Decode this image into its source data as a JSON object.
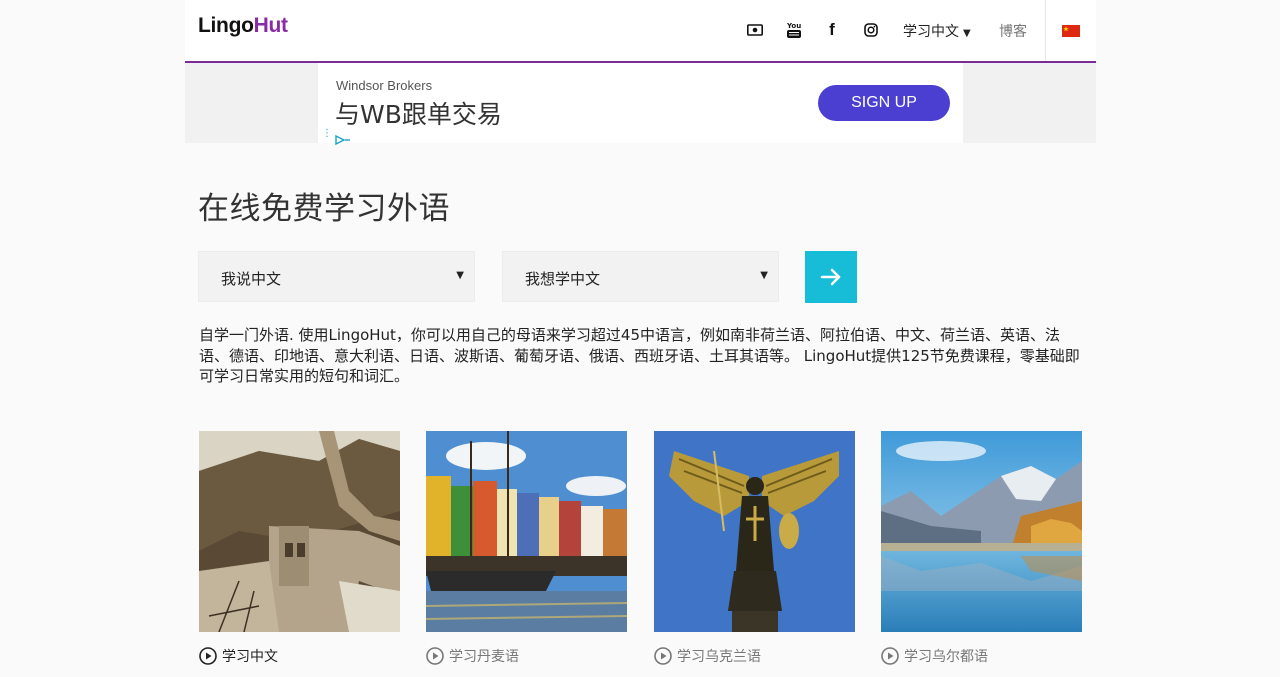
{
  "header": {
    "logo_part1": "Lingo",
    "logo_part2": "Hut",
    "language_menu": "学习中文",
    "blog_link": "博客",
    "social_icons": [
      "money-icon",
      "youtube-icon",
      "facebook-icon",
      "instagram-icon"
    ],
    "youtube_glyph": "You",
    "facebook_glyph": "f",
    "flag": "china-flag-icon",
    "accent_color": "#7b2a9a"
  },
  "ad": {
    "sponsor": "Windsor Brokers",
    "headline": "与WB跟单交易",
    "cta": "SIGN UP",
    "cta_color": "#4a3fd1"
  },
  "main": {
    "title": "在线免费学习外语",
    "speak_select": "我说中文",
    "learn_select": "我想学中文",
    "go_button_color": "#17bcd7",
    "intro": "自学一门外语. 使用LingoHut，你可以用自己的母语来学习超过45中语言，例如南非荷兰语、阿拉伯语、中文、荷兰语、英语、法语、德语、印地语、意大利语、日语、波斯语、葡萄牙语、俄语、西班牙语、土耳其语等。 LingoHut提供125节免费课程，零基础即可学习日常实用的短句和词汇。"
  },
  "cards": [
    {
      "label": "学习中文",
      "image": "great-wall-image"
    },
    {
      "label": "学习丹麦语",
      "image": "copenhagen-harbor-image"
    },
    {
      "label": "学习乌克兰语",
      "image": "archangel-statue-image"
    },
    {
      "label": "学习乌尔都语",
      "image": "mountain-lake-image"
    }
  ]
}
